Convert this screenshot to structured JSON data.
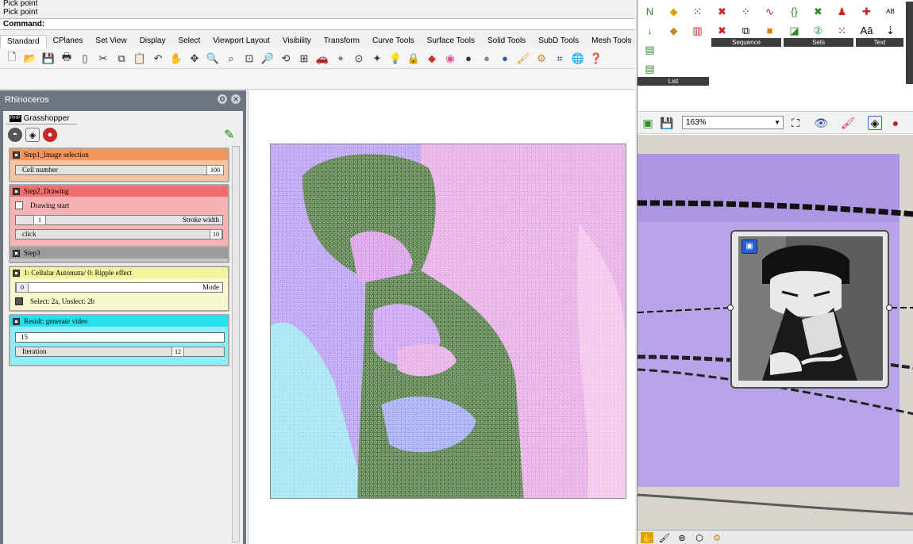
{
  "command_history": [
    "Pick point",
    "Pick point"
  ],
  "command_prompt": "Command:",
  "rhino_tabs": [
    "Standard",
    "CPlanes",
    "Set View",
    "Display",
    "Select",
    "Viewport Layout",
    "Visibility",
    "Transform",
    "Curve Tools",
    "Surface Tools",
    "Solid Tools",
    "SubD Tools",
    "Mesh Tools"
  ],
  "panel": {
    "title": "Rhinoceros",
    "tab": "Grasshopper",
    "tab_logo": "RHP"
  },
  "groups": [
    {
      "title": "Step1_Image selection",
      "color": "#f2955a",
      "fields": {
        "cell_label": "Cell number",
        "cell_value": "100"
      }
    },
    {
      "title": "Step2_Drawing",
      "color": "#f06e6e",
      "fields": {
        "toggle_label": "Drawing start",
        "stroke_knob": "1",
        "stroke_label": "Stroke width",
        "click_label": "click",
        "click_value": "10"
      }
    },
    {
      "title": "Step3",
      "color": "#9b9b9b"
    },
    {
      "title": "1: Cellular Automata/ 0: Ripple effect",
      "color": "#f1f59d",
      "fields": {
        "mode_knob": "0",
        "mode_label": "Mode",
        "select_label": "Select: 2a, Unslect: 2b"
      }
    },
    {
      "title": "Result: generate video",
      "color": "#26e0f0",
      "fields": {
        "frames_value": "15",
        "iteration_label": "Iteration",
        "iteration_value": "12"
      }
    }
  ],
  "gh_ribbon": {
    "groups": [
      "List",
      "Sequence",
      "Sets",
      "Text"
    ]
  },
  "gh_zoom": "163%",
  "colors": {
    "panel_bg": "#6d7580",
    "gh_canvas": "#d7d4cd",
    "gh_group": "#b7a3e8",
    "mosaic_green": "#4f7a42",
    "mosaic_pink": "#e7a9e6",
    "mosaic_purple": "#b79cf0",
    "mosaic_cyan": "#9fe3f0"
  }
}
